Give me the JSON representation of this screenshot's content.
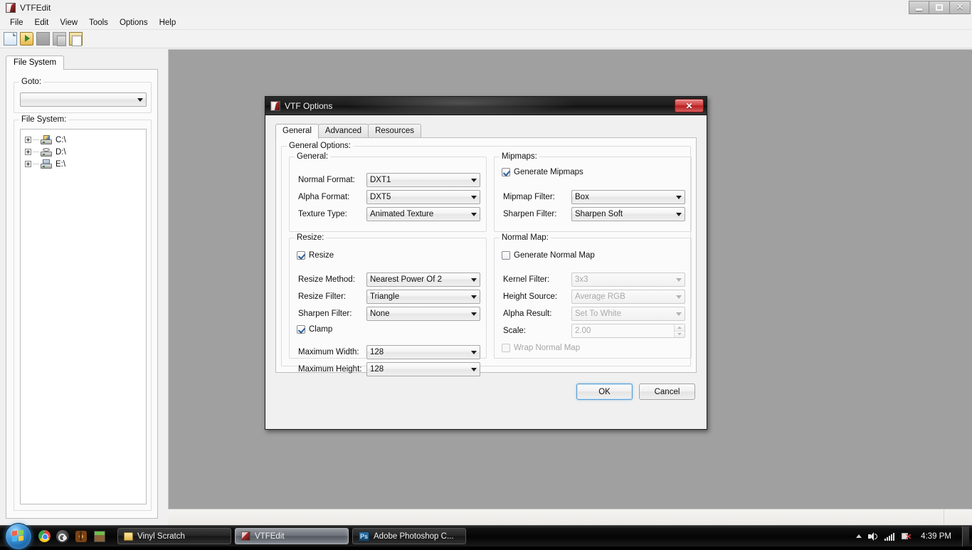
{
  "app": {
    "title": "VTFEdit",
    "icon": "vtf-logo-icon",
    "window_buttons": {
      "minimize": "minimize-icon",
      "maximize": "maximize-icon",
      "close": "✕"
    },
    "menubar": [
      "File",
      "Edit",
      "View",
      "Tools",
      "Options",
      "Help"
    ],
    "toolbar": [
      {
        "name": "new-file-icon"
      },
      {
        "name": "open-file-icon"
      },
      {
        "name": "save-file-icon"
      },
      {
        "name": "copy-icon"
      },
      {
        "name": "paste-icon"
      }
    ]
  },
  "left_panel": {
    "tab_label": "File System",
    "goto": {
      "legend": "Goto:",
      "value": "",
      "placeholder": ""
    },
    "filesystem": {
      "legend": "File System:",
      "nodes": [
        {
          "label": "C:\\",
          "icon": "hard-drive-icon",
          "expander": "+"
        },
        {
          "label": "D:\\",
          "icon": "cd-drive-icon",
          "expander": "+"
        },
        {
          "label": "E:\\",
          "icon": "network-drive-icon",
          "expander": "+"
        }
      ]
    }
  },
  "dialog": {
    "title": "VTF Options",
    "icon": "vtf-logo-icon",
    "close_label": "✕",
    "tabs": [
      {
        "label": "General",
        "active": true
      },
      {
        "label": "Advanced",
        "active": false
      },
      {
        "label": "Resources",
        "active": false
      }
    ],
    "general_options_legend": "General Options:",
    "general": {
      "legend": "General:",
      "normal_format": {
        "label": "Normal Format:",
        "value": "DXT1"
      },
      "alpha_format": {
        "label": "Alpha Format:",
        "value": "DXT5"
      },
      "texture_type": {
        "label": "Texture Type:",
        "value": "Animated Texture"
      }
    },
    "resize": {
      "legend": "Resize:",
      "resize_check": {
        "label": "Resize",
        "checked": true
      },
      "resize_method": {
        "label": "Resize Method:",
        "value": "Nearest Power Of 2"
      },
      "resize_filter": {
        "label": "Resize Filter:",
        "value": "Triangle"
      },
      "sharpen_filter": {
        "label": "Sharpen Filter:",
        "value": "None"
      },
      "clamp_check": {
        "label": "Clamp",
        "checked": true
      },
      "maximum_width": {
        "label": "Maximum Width:",
        "value": "128"
      },
      "maximum_height": {
        "label": "Maximum Height:",
        "value": "128"
      }
    },
    "mipmaps": {
      "legend": "Mipmaps:",
      "generate_check": {
        "label": "Generate Mipmaps",
        "checked": true
      },
      "mipmap_filter": {
        "label": "Mipmap Filter:",
        "value": "Box"
      },
      "sharpen_filter": {
        "label": "Sharpen Filter:",
        "value": "Sharpen Soft"
      }
    },
    "normal_map": {
      "legend": "Normal Map:",
      "generate_check": {
        "label": "Generate Normal Map",
        "checked": false
      },
      "kernel_filter": {
        "label": "Kernel Filter:",
        "value": "3x3"
      },
      "height_source": {
        "label": "Height Source:",
        "value": "Average RGB"
      },
      "alpha_result": {
        "label": "Alpha Result:",
        "value": "Set To White"
      },
      "scale": {
        "label": "Scale:",
        "value": "2.00"
      },
      "wrap_check": {
        "label": "Wrap Normal Map",
        "checked": false
      }
    },
    "buttons": {
      "ok": "OK",
      "cancel": "Cancel"
    }
  },
  "taskbar": {
    "start": "start-orb-icon",
    "quicklaunch": [
      {
        "name": "chrome-icon"
      },
      {
        "name": "steam-icon"
      },
      {
        "name": "oblivion-icon"
      },
      {
        "name": "minecraft-icon"
      }
    ],
    "windows": [
      {
        "label": "Vinyl Scratch",
        "icon": "folder-icon",
        "active": false
      },
      {
        "label": "VTFEdit",
        "icon": "vtf-logo-icon",
        "active": true
      },
      {
        "label": "Adobe Photoshop C...",
        "icon": "photoshop-icon",
        "active": false
      }
    ],
    "tray": {
      "show_hidden": "chevron-up-icon",
      "volume": "volume-icon",
      "network": "network-signal-icon",
      "power": "power-plug-icon",
      "clock": "4:39 PM"
    }
  },
  "colors": {
    "accent_ok": "#5a9fd4",
    "close_red": "#b82020",
    "workspace": "#a0a0a0",
    "chrome": "#f0f0f0"
  }
}
